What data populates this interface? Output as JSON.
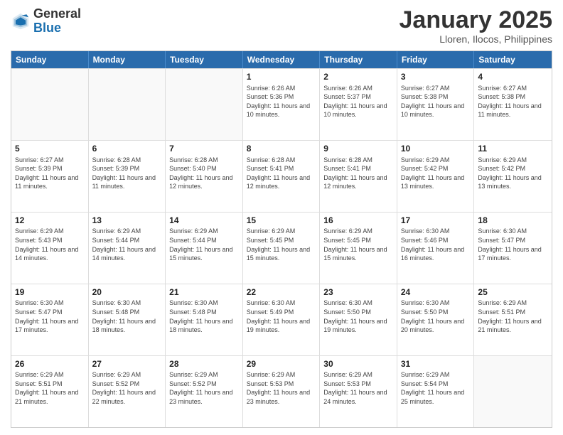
{
  "logo": {
    "general": "General",
    "blue": "Blue"
  },
  "title": "January 2025",
  "location": "Lloren, Ilocos, Philippines",
  "days_of_week": [
    "Sunday",
    "Monday",
    "Tuesday",
    "Wednesday",
    "Thursday",
    "Friday",
    "Saturday"
  ],
  "weeks": [
    [
      {
        "day": "",
        "info": ""
      },
      {
        "day": "",
        "info": ""
      },
      {
        "day": "",
        "info": ""
      },
      {
        "day": "1",
        "info": "Sunrise: 6:26 AM\nSunset: 5:36 PM\nDaylight: 11 hours and 10 minutes."
      },
      {
        "day": "2",
        "info": "Sunrise: 6:26 AM\nSunset: 5:37 PM\nDaylight: 11 hours and 10 minutes."
      },
      {
        "day": "3",
        "info": "Sunrise: 6:27 AM\nSunset: 5:38 PM\nDaylight: 11 hours and 10 minutes."
      },
      {
        "day": "4",
        "info": "Sunrise: 6:27 AM\nSunset: 5:38 PM\nDaylight: 11 hours and 11 minutes."
      }
    ],
    [
      {
        "day": "5",
        "info": "Sunrise: 6:27 AM\nSunset: 5:39 PM\nDaylight: 11 hours and 11 minutes."
      },
      {
        "day": "6",
        "info": "Sunrise: 6:28 AM\nSunset: 5:39 PM\nDaylight: 11 hours and 11 minutes."
      },
      {
        "day": "7",
        "info": "Sunrise: 6:28 AM\nSunset: 5:40 PM\nDaylight: 11 hours and 12 minutes."
      },
      {
        "day": "8",
        "info": "Sunrise: 6:28 AM\nSunset: 5:41 PM\nDaylight: 11 hours and 12 minutes."
      },
      {
        "day": "9",
        "info": "Sunrise: 6:28 AM\nSunset: 5:41 PM\nDaylight: 11 hours and 12 minutes."
      },
      {
        "day": "10",
        "info": "Sunrise: 6:29 AM\nSunset: 5:42 PM\nDaylight: 11 hours and 13 minutes."
      },
      {
        "day": "11",
        "info": "Sunrise: 6:29 AM\nSunset: 5:42 PM\nDaylight: 11 hours and 13 minutes."
      }
    ],
    [
      {
        "day": "12",
        "info": "Sunrise: 6:29 AM\nSunset: 5:43 PM\nDaylight: 11 hours and 14 minutes."
      },
      {
        "day": "13",
        "info": "Sunrise: 6:29 AM\nSunset: 5:44 PM\nDaylight: 11 hours and 14 minutes."
      },
      {
        "day": "14",
        "info": "Sunrise: 6:29 AM\nSunset: 5:44 PM\nDaylight: 11 hours and 15 minutes."
      },
      {
        "day": "15",
        "info": "Sunrise: 6:29 AM\nSunset: 5:45 PM\nDaylight: 11 hours and 15 minutes."
      },
      {
        "day": "16",
        "info": "Sunrise: 6:29 AM\nSunset: 5:45 PM\nDaylight: 11 hours and 15 minutes."
      },
      {
        "day": "17",
        "info": "Sunrise: 6:30 AM\nSunset: 5:46 PM\nDaylight: 11 hours and 16 minutes."
      },
      {
        "day": "18",
        "info": "Sunrise: 6:30 AM\nSunset: 5:47 PM\nDaylight: 11 hours and 17 minutes."
      }
    ],
    [
      {
        "day": "19",
        "info": "Sunrise: 6:30 AM\nSunset: 5:47 PM\nDaylight: 11 hours and 17 minutes."
      },
      {
        "day": "20",
        "info": "Sunrise: 6:30 AM\nSunset: 5:48 PM\nDaylight: 11 hours and 18 minutes."
      },
      {
        "day": "21",
        "info": "Sunrise: 6:30 AM\nSunset: 5:48 PM\nDaylight: 11 hours and 18 minutes."
      },
      {
        "day": "22",
        "info": "Sunrise: 6:30 AM\nSunset: 5:49 PM\nDaylight: 11 hours and 19 minutes."
      },
      {
        "day": "23",
        "info": "Sunrise: 6:30 AM\nSunset: 5:50 PM\nDaylight: 11 hours and 19 minutes."
      },
      {
        "day": "24",
        "info": "Sunrise: 6:30 AM\nSunset: 5:50 PM\nDaylight: 11 hours and 20 minutes."
      },
      {
        "day": "25",
        "info": "Sunrise: 6:29 AM\nSunset: 5:51 PM\nDaylight: 11 hours and 21 minutes."
      }
    ],
    [
      {
        "day": "26",
        "info": "Sunrise: 6:29 AM\nSunset: 5:51 PM\nDaylight: 11 hours and 21 minutes."
      },
      {
        "day": "27",
        "info": "Sunrise: 6:29 AM\nSunset: 5:52 PM\nDaylight: 11 hours and 22 minutes."
      },
      {
        "day": "28",
        "info": "Sunrise: 6:29 AM\nSunset: 5:52 PM\nDaylight: 11 hours and 23 minutes."
      },
      {
        "day": "29",
        "info": "Sunrise: 6:29 AM\nSunset: 5:53 PM\nDaylight: 11 hours and 23 minutes."
      },
      {
        "day": "30",
        "info": "Sunrise: 6:29 AM\nSunset: 5:53 PM\nDaylight: 11 hours and 24 minutes."
      },
      {
        "day": "31",
        "info": "Sunrise: 6:29 AM\nSunset: 5:54 PM\nDaylight: 11 hours and 25 minutes."
      },
      {
        "day": "",
        "info": ""
      }
    ]
  ]
}
